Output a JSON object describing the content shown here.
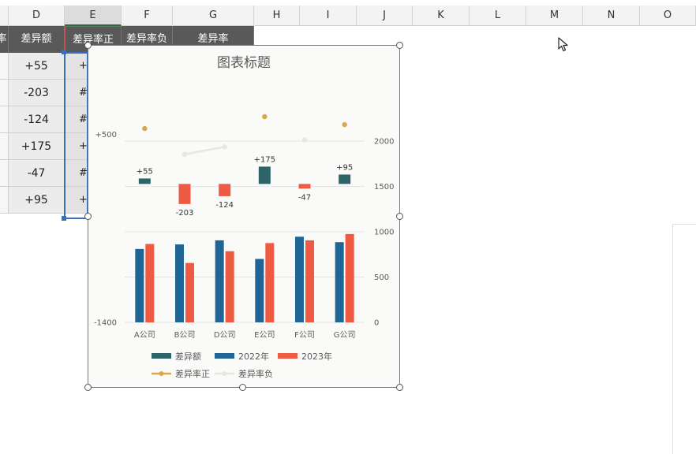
{
  "columns": [
    "D",
    "E",
    "F",
    "G",
    "H",
    "I",
    "J",
    "K",
    "L",
    "M",
    "N",
    "O"
  ],
  "table_header": {
    "partial_left": "率",
    "col_d": "差异额",
    "col_e": "差异率正",
    "col_f": "差异率负",
    "col_g": "差异率"
  },
  "rows": [
    {
      "d": "+55",
      "e": "+"
    },
    {
      "d": "-203",
      "e": "#"
    },
    {
      "d": "-124",
      "e": "#"
    },
    {
      "d": "+175",
      "e": "+"
    },
    {
      "d": "-47",
      "e": "#"
    },
    {
      "d": "+95",
      "e": "+"
    }
  ],
  "colors": {
    "diff": "#2e6468",
    "y2022": "#1f6696",
    "y2023": "#ef5a43",
    "pos": "#d9a84a",
    "neg": "#e6e7de"
  },
  "chart_data": {
    "type": "bar",
    "title": "图表标题",
    "categories": [
      "A公司",
      "B公司",
      "D公司",
      "E公司",
      "F公司",
      "G公司"
    ],
    "series": [
      {
        "name": "差异额",
        "axis": "left",
        "type": "bar",
        "values": [
          55,
          -203,
          -124,
          175,
          -47,
          95
        ],
        "labels": [
          "+55",
          "-203",
          "-124",
          "+175",
          "-47",
          "+95"
        ]
      },
      {
        "name": "2022年",
        "axis": "right",
        "type": "bar",
        "values": [
          810,
          860,
          905,
          700,
          945,
          885
        ]
      },
      {
        "name": "2023年",
        "axis": "right",
        "type": "bar",
        "values": [
          865,
          655,
          785,
          875,
          905,
          975
        ]
      },
      {
        "name": "差异率正",
        "axis": "left",
        "type": "line",
        "values": [
          560,
          null,
          null,
          680,
          null,
          600
        ]
      },
      {
        "name": "差异率负",
        "axis": "left",
        "type": "line",
        "values": [
          null,
          300,
          375,
          null,
          445,
          null
        ]
      }
    ],
    "left_axis": {
      "range": [
        -1400,
        800
      ],
      "ticks": [
        "+500",
        "-1400"
      ]
    },
    "right_axis": {
      "range": [
        0,
        2400
      ],
      "ticks": [
        "0",
        "500",
        "1000",
        "1500",
        "2000"
      ]
    },
    "grid": true,
    "legend": "bottom"
  }
}
